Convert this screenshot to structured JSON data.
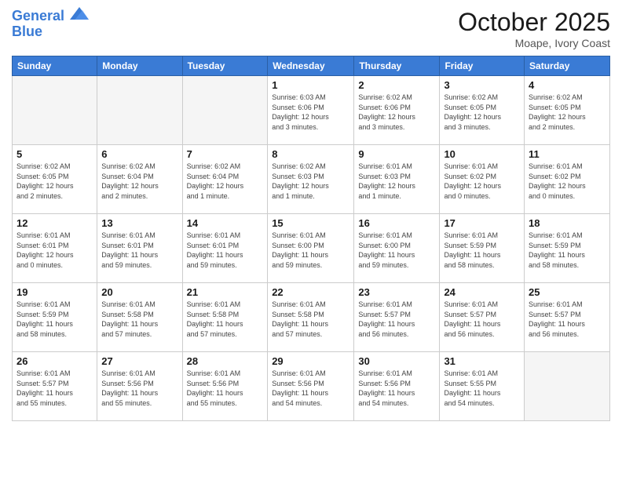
{
  "header": {
    "logo_line1": "General",
    "logo_line2": "Blue",
    "month": "October 2025",
    "location": "Moape, Ivory Coast"
  },
  "days_of_week": [
    "Sunday",
    "Monday",
    "Tuesday",
    "Wednesday",
    "Thursday",
    "Friday",
    "Saturday"
  ],
  "weeks": [
    [
      {
        "day": "",
        "info": ""
      },
      {
        "day": "",
        "info": ""
      },
      {
        "day": "",
        "info": ""
      },
      {
        "day": "1",
        "info": "Sunrise: 6:03 AM\nSunset: 6:06 PM\nDaylight: 12 hours\nand 3 minutes."
      },
      {
        "day": "2",
        "info": "Sunrise: 6:02 AM\nSunset: 6:06 PM\nDaylight: 12 hours\nand 3 minutes."
      },
      {
        "day": "3",
        "info": "Sunrise: 6:02 AM\nSunset: 6:05 PM\nDaylight: 12 hours\nand 3 minutes."
      },
      {
        "day": "4",
        "info": "Sunrise: 6:02 AM\nSunset: 6:05 PM\nDaylight: 12 hours\nand 2 minutes."
      }
    ],
    [
      {
        "day": "5",
        "info": "Sunrise: 6:02 AM\nSunset: 6:05 PM\nDaylight: 12 hours\nand 2 minutes."
      },
      {
        "day": "6",
        "info": "Sunrise: 6:02 AM\nSunset: 6:04 PM\nDaylight: 12 hours\nand 2 minutes."
      },
      {
        "day": "7",
        "info": "Sunrise: 6:02 AM\nSunset: 6:04 PM\nDaylight: 12 hours\nand 1 minute."
      },
      {
        "day": "8",
        "info": "Sunrise: 6:02 AM\nSunset: 6:03 PM\nDaylight: 12 hours\nand 1 minute."
      },
      {
        "day": "9",
        "info": "Sunrise: 6:01 AM\nSunset: 6:03 PM\nDaylight: 12 hours\nand 1 minute."
      },
      {
        "day": "10",
        "info": "Sunrise: 6:01 AM\nSunset: 6:02 PM\nDaylight: 12 hours\nand 0 minutes."
      },
      {
        "day": "11",
        "info": "Sunrise: 6:01 AM\nSunset: 6:02 PM\nDaylight: 12 hours\nand 0 minutes."
      }
    ],
    [
      {
        "day": "12",
        "info": "Sunrise: 6:01 AM\nSunset: 6:01 PM\nDaylight: 12 hours\nand 0 minutes."
      },
      {
        "day": "13",
        "info": "Sunrise: 6:01 AM\nSunset: 6:01 PM\nDaylight: 11 hours\nand 59 minutes."
      },
      {
        "day": "14",
        "info": "Sunrise: 6:01 AM\nSunset: 6:01 PM\nDaylight: 11 hours\nand 59 minutes."
      },
      {
        "day": "15",
        "info": "Sunrise: 6:01 AM\nSunset: 6:00 PM\nDaylight: 11 hours\nand 59 minutes."
      },
      {
        "day": "16",
        "info": "Sunrise: 6:01 AM\nSunset: 6:00 PM\nDaylight: 11 hours\nand 59 minutes."
      },
      {
        "day": "17",
        "info": "Sunrise: 6:01 AM\nSunset: 5:59 PM\nDaylight: 11 hours\nand 58 minutes."
      },
      {
        "day": "18",
        "info": "Sunrise: 6:01 AM\nSunset: 5:59 PM\nDaylight: 11 hours\nand 58 minutes."
      }
    ],
    [
      {
        "day": "19",
        "info": "Sunrise: 6:01 AM\nSunset: 5:59 PM\nDaylight: 11 hours\nand 58 minutes."
      },
      {
        "day": "20",
        "info": "Sunrise: 6:01 AM\nSunset: 5:58 PM\nDaylight: 11 hours\nand 57 minutes."
      },
      {
        "day": "21",
        "info": "Sunrise: 6:01 AM\nSunset: 5:58 PM\nDaylight: 11 hours\nand 57 minutes."
      },
      {
        "day": "22",
        "info": "Sunrise: 6:01 AM\nSunset: 5:58 PM\nDaylight: 11 hours\nand 57 minutes."
      },
      {
        "day": "23",
        "info": "Sunrise: 6:01 AM\nSunset: 5:57 PM\nDaylight: 11 hours\nand 56 minutes."
      },
      {
        "day": "24",
        "info": "Sunrise: 6:01 AM\nSunset: 5:57 PM\nDaylight: 11 hours\nand 56 minutes."
      },
      {
        "day": "25",
        "info": "Sunrise: 6:01 AM\nSunset: 5:57 PM\nDaylight: 11 hours\nand 56 minutes."
      }
    ],
    [
      {
        "day": "26",
        "info": "Sunrise: 6:01 AM\nSunset: 5:57 PM\nDaylight: 11 hours\nand 55 minutes."
      },
      {
        "day": "27",
        "info": "Sunrise: 6:01 AM\nSunset: 5:56 PM\nDaylight: 11 hours\nand 55 minutes."
      },
      {
        "day": "28",
        "info": "Sunrise: 6:01 AM\nSunset: 5:56 PM\nDaylight: 11 hours\nand 55 minutes."
      },
      {
        "day": "29",
        "info": "Sunrise: 6:01 AM\nSunset: 5:56 PM\nDaylight: 11 hours\nand 54 minutes."
      },
      {
        "day": "30",
        "info": "Sunrise: 6:01 AM\nSunset: 5:56 PM\nDaylight: 11 hours\nand 54 minutes."
      },
      {
        "day": "31",
        "info": "Sunrise: 6:01 AM\nSunset: 5:55 PM\nDaylight: 11 hours\nand 54 minutes."
      },
      {
        "day": "",
        "info": ""
      }
    ]
  ]
}
